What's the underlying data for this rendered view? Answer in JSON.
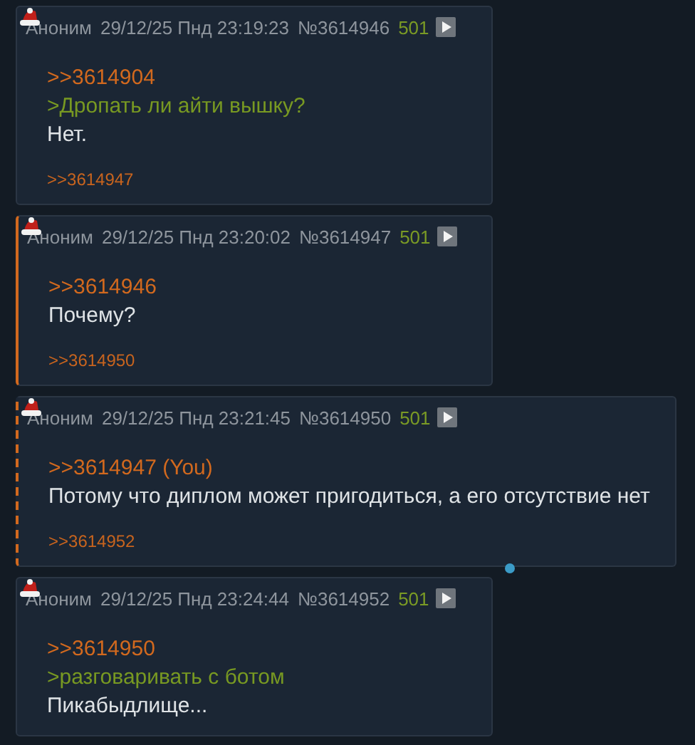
{
  "posts": [
    {
      "kind": "plain",
      "name": "Аноним",
      "date": "29/12/25 Пнд 23:19:23",
      "number": "№3614946",
      "count": "501",
      "lines": [
        {
          "kind": "reply",
          "text": ">>3614904"
        },
        {
          "kind": "quote",
          "text": ">Дропать ли айти вышку?"
        },
        {
          "kind": "text",
          "text": "Нет."
        }
      ],
      "backlinks": [
        ">>3614947"
      ]
    },
    {
      "kind": "own",
      "name": "Аноним",
      "date": "29/12/25 Пнд 23:20:02",
      "number": "№3614947",
      "count": "501",
      "lines": [
        {
          "kind": "reply",
          "text": ">>3614946"
        },
        {
          "kind": "text",
          "text": "Почему?"
        }
      ],
      "backlinks": [
        ">>3614950"
      ]
    },
    {
      "kind": "answer",
      "name": "Аноним",
      "date": "29/12/25 Пнд 23:21:45",
      "number": "№3614950",
      "count": "501",
      "lines": [
        {
          "kind": "reply",
          "text": ">>3614947 (You)"
        },
        {
          "kind": "text",
          "text": "Потому что диплом может пригодиться, а его отсутствие нет"
        }
      ],
      "backlinks": [
        ">>3614952"
      ]
    },
    {
      "kind": "plain",
      "name": "Аноним",
      "date": "29/12/25 Пнд 23:24:44",
      "number": "№3614952",
      "count": "501",
      "lines": [
        {
          "kind": "reply",
          "text": ">>3614950"
        },
        {
          "kind": "quote",
          "text": ">разговаривать с ботом"
        },
        {
          "kind": "text",
          "text": "Пикабыдлище..."
        }
      ]
    }
  ]
}
